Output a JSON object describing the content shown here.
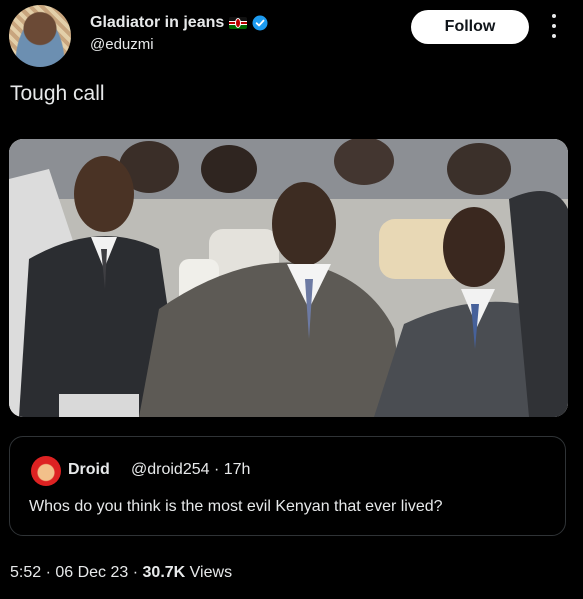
{
  "author": {
    "name": "Gladiator in jeans",
    "handle": "@eduzmi",
    "flag": "kenya-flag-icon",
    "verified": "verified-badge-icon"
  },
  "actions": {
    "follow_label": "Follow",
    "more_icon": "more-vertical-icon"
  },
  "tweet": {
    "text": "Tough call",
    "media": "photo of seated men in suits"
  },
  "quote": {
    "name": "Droid",
    "handle": "@droid254",
    "time": "17h",
    "text": "Whos do you think is the most evil Kenyan that ever lived?"
  },
  "meta": {
    "time": "5:52",
    "date": "06 Dec 23",
    "views": "30.7K",
    "views_label": "Views"
  },
  "colors": {
    "background": "#000000",
    "text": "#e7e9ea",
    "verified": "#1d9bf0",
    "border": "#2f3336"
  }
}
